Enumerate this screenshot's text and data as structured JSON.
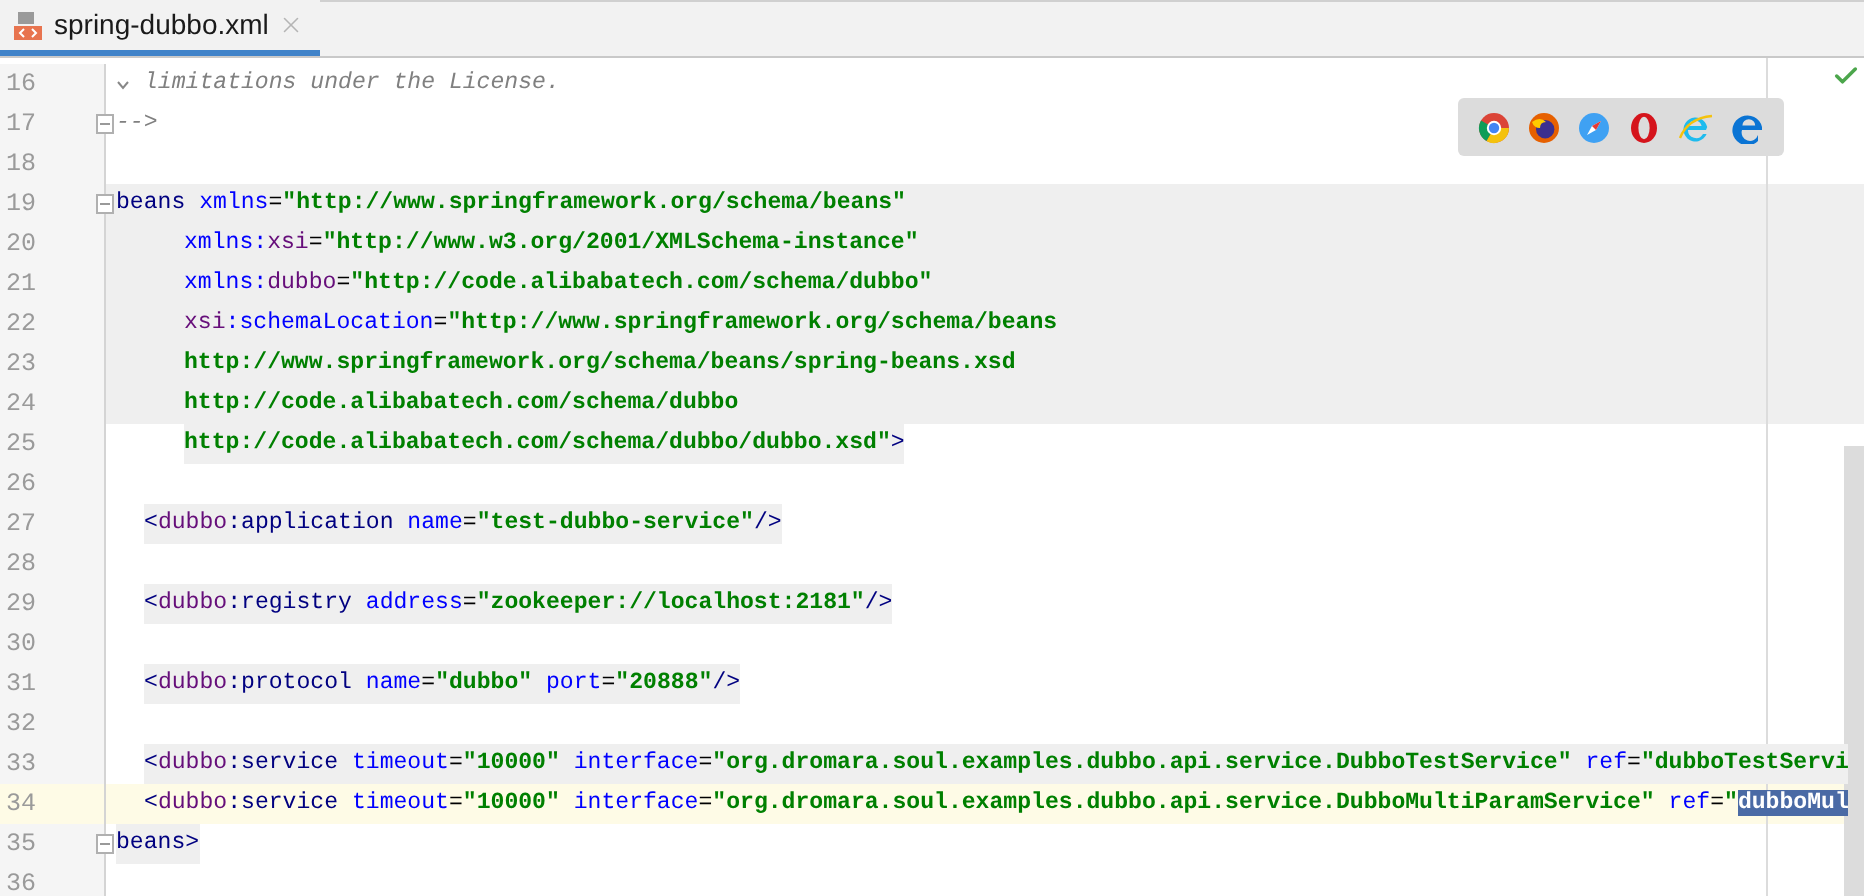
{
  "tabs": [
    {
      "label": "spring-dubbo.xml",
      "selected": true
    }
  ],
  "lines": [
    {
      "number": "16",
      "chevron": true,
      "segments": [
        {
          "kind": "comment",
          "text": "limitations under the License."
        }
      ]
    },
    {
      "number": "17",
      "fold": true,
      "segments": [
        {
          "kind": "comment",
          "text": "-->"
        }
      ]
    },
    {
      "number": "18"
    },
    {
      "number": "19",
      "fold": true,
      "block_shaded": true,
      "segments": [
        {
          "kind": "tag",
          "text": "beans"
        },
        {
          "kind": "attr",
          "text": " xmlns"
        },
        {
          "kind": "punct",
          "text": "="
        },
        {
          "kind": "value",
          "text": "\"http://www.springframework.org/schema/beans\""
        }
      ]
    },
    {
      "number": "20",
      "block_shaded": true,
      "continuation": true,
      "segments": [
        {
          "kind": "attr",
          "text": "xmlns:"
        },
        {
          "kind": "ns",
          "text": "xsi"
        },
        {
          "kind": "punct",
          "text": "="
        },
        {
          "kind": "value",
          "text": "\"http://www.w3.org/2001/XMLSchema-instance\""
        }
      ]
    },
    {
      "number": "21",
      "block_shaded": true,
      "continuation": true,
      "segments": [
        {
          "kind": "attr",
          "text": "xmlns:"
        },
        {
          "kind": "ns",
          "text": "dubbo"
        },
        {
          "kind": "punct",
          "text": "="
        },
        {
          "kind": "value",
          "text": "\"http://code.alibabatech.com/schema/dubbo\""
        }
      ]
    },
    {
      "number": "22",
      "block_shaded": true,
      "continuation": true,
      "segments": [
        {
          "kind": "ns",
          "text": "xsi"
        },
        {
          "kind": "attr",
          "text": ":schemaLocation"
        },
        {
          "kind": "punct",
          "text": "="
        },
        {
          "kind": "value",
          "text": "\"http://www.springframework.org/schema/beans"
        }
      ]
    },
    {
      "number": "23",
      "block_shaded": true,
      "continuation": true,
      "segments": [
        {
          "kind": "value",
          "text": "http://www.springframework.org/schema/beans/spring-beans.xsd"
        }
      ]
    },
    {
      "number": "24",
      "block_shaded": true,
      "continuation": true,
      "segments": [
        {
          "kind": "value",
          "text": "http://code.alibabatech.com/schema/dubbo"
        }
      ]
    },
    {
      "number": "25",
      "shaded": true,
      "continuation": true,
      "segments": [
        {
          "kind": "value",
          "text": "http://code.alibabatech.com/schema/dubbo/dubbo.xsd\""
        },
        {
          "kind": "tag",
          "text": ">"
        }
      ]
    },
    {
      "number": "26"
    },
    {
      "number": "27",
      "nested": true,
      "shaded": true,
      "segments": [
        {
          "kind": "tag",
          "text": "<"
        },
        {
          "kind": "ns",
          "text": "dubbo"
        },
        {
          "kind": "tag",
          "text": ":application"
        },
        {
          "kind": "attr",
          "text": " name"
        },
        {
          "kind": "punct",
          "text": "="
        },
        {
          "kind": "value",
          "text": "\"test-dubbo-service\""
        },
        {
          "kind": "tag",
          "text": "/>"
        }
      ]
    },
    {
      "number": "28"
    },
    {
      "number": "29",
      "nested": true,
      "shaded": true,
      "segments": [
        {
          "kind": "tag",
          "text": "<"
        },
        {
          "kind": "ns",
          "text": "dubbo"
        },
        {
          "kind": "tag",
          "text": ":registry"
        },
        {
          "kind": "attr",
          "text": " address"
        },
        {
          "kind": "punct",
          "text": "="
        },
        {
          "kind": "value",
          "text": "\"zookeeper://localhost:2181\""
        },
        {
          "kind": "tag",
          "text": "/>"
        }
      ]
    },
    {
      "number": "30"
    },
    {
      "number": "31",
      "nested": true,
      "shaded": true,
      "segments": [
        {
          "kind": "tag",
          "text": "<"
        },
        {
          "kind": "ns",
          "text": "dubbo"
        },
        {
          "kind": "tag",
          "text": ":protocol"
        },
        {
          "kind": "attr",
          "text": " name"
        },
        {
          "kind": "punct",
          "text": "="
        },
        {
          "kind": "value",
          "text": "\"dubbo\""
        },
        {
          "kind": "attr",
          "text": " port"
        },
        {
          "kind": "punct",
          "text": "="
        },
        {
          "kind": "value",
          "text": "\"20888\""
        },
        {
          "kind": "tag",
          "text": "/>"
        }
      ]
    },
    {
      "number": "32"
    },
    {
      "number": "33",
      "nested": true,
      "shaded": true,
      "segments": [
        {
          "kind": "tag",
          "text": "<"
        },
        {
          "kind": "ns",
          "text": "dubbo"
        },
        {
          "kind": "tag",
          "text": ":service"
        },
        {
          "kind": "attr",
          "text": " timeout"
        },
        {
          "kind": "punct",
          "text": "="
        },
        {
          "kind": "value",
          "text": "\"10000\""
        },
        {
          "kind": "attr",
          "text": " interface"
        },
        {
          "kind": "punct",
          "text": "="
        },
        {
          "kind": "value",
          "text": "\"org.dromara.soul.examples.dubbo.api.service.DubboTestService\""
        },
        {
          "kind": "attr",
          "text": " ref"
        },
        {
          "kind": "punct",
          "text": "="
        },
        {
          "kind": "value",
          "text": "\"dubboTestServi"
        }
      ]
    },
    {
      "number": "34",
      "nested": true,
      "current": true,
      "segments": [
        {
          "kind": "tag",
          "text": "<"
        },
        {
          "kind": "ns",
          "text": "dubbo"
        },
        {
          "kind": "tag",
          "text": ":service"
        },
        {
          "kind": "attr",
          "text": " timeout"
        },
        {
          "kind": "punct",
          "text": "="
        },
        {
          "kind": "value",
          "text": "\"10000\""
        },
        {
          "kind": "attr",
          "text": " interface"
        },
        {
          "kind": "punct",
          "text": "="
        },
        {
          "kind": "value",
          "text": "\"org.dromara.soul.examples.dubbo.api.service.DubboMultiParamService\""
        },
        {
          "kind": "attr",
          "text": " ref"
        },
        {
          "kind": "punct",
          "text": "="
        },
        {
          "kind": "value",
          "text": "\""
        },
        {
          "kind": "selection",
          "text": "dubboMul"
        }
      ]
    },
    {
      "number": "35",
      "fold": true,
      "shaded": true,
      "segments": [
        {
          "kind": "tag",
          "text": "beans>"
        }
      ]
    },
    {
      "number": "36"
    }
  ]
}
